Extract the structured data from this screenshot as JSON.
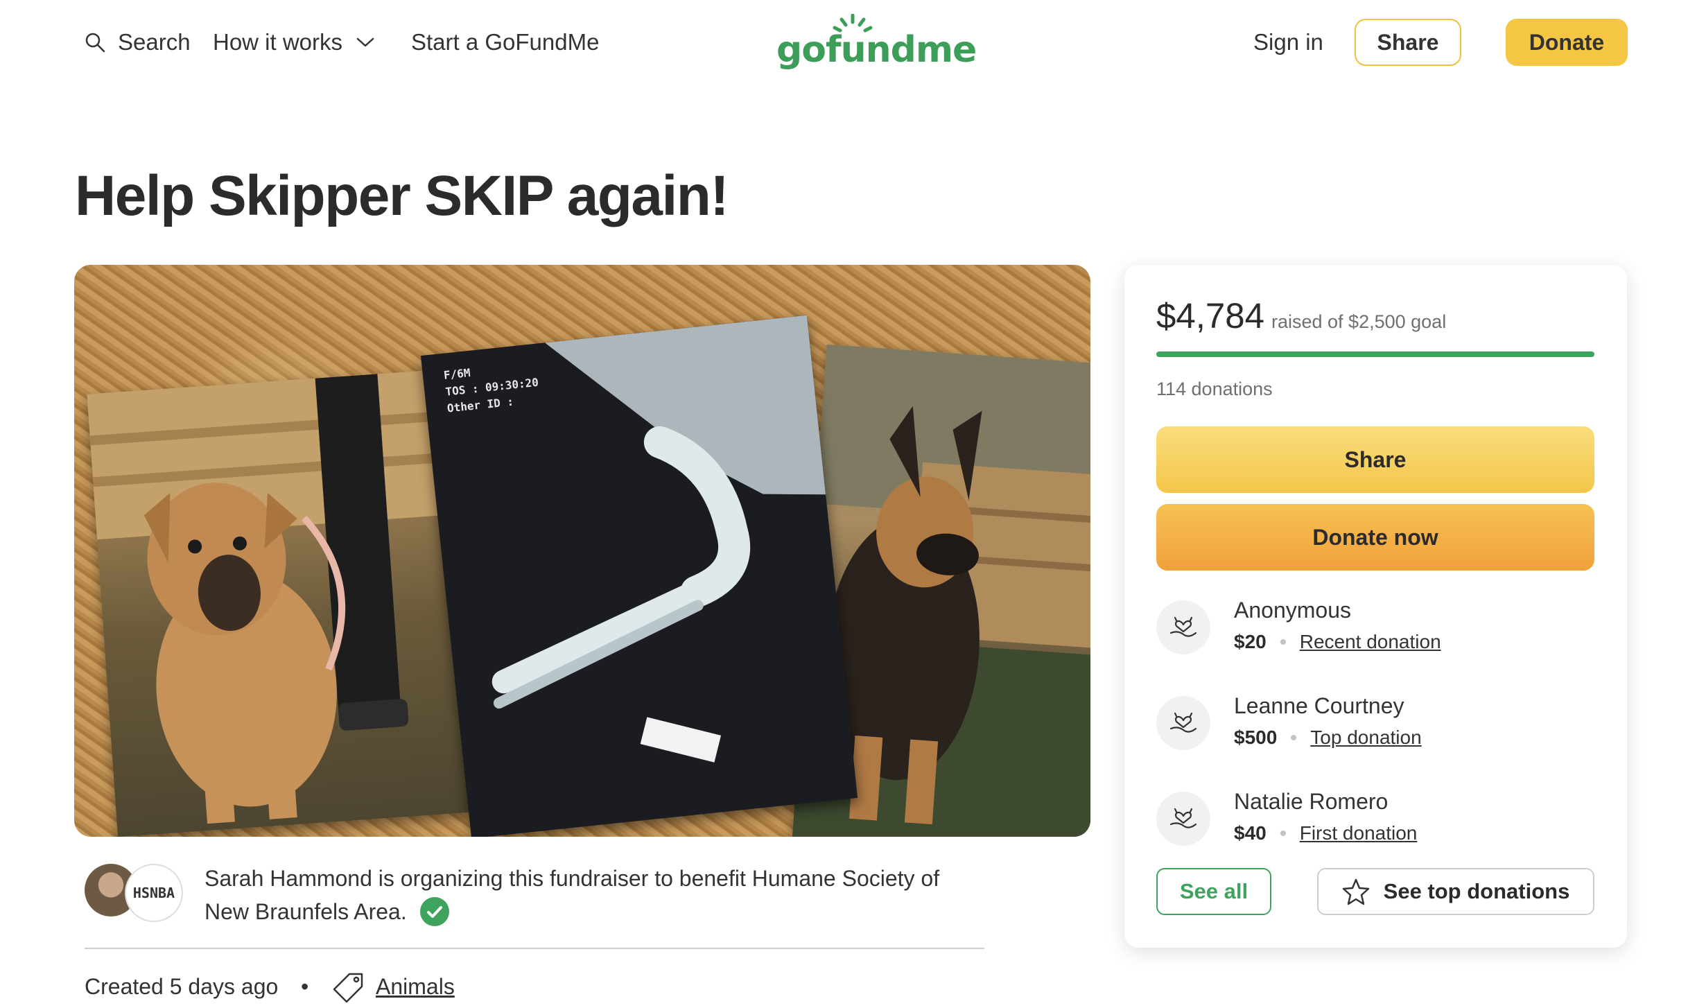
{
  "nav": {
    "search_label": "Search",
    "how_it_works_label": "How it works",
    "start_label": "Start a GoFundMe",
    "logo_text": "gofundme",
    "sign_in_label": "Sign in",
    "share_label": "Share",
    "donate_label": "Donate"
  },
  "campaign": {
    "title": "Help Skipper SKIP again!",
    "image": {
      "xray_caption_lines": [
        "F/6M",
        "TOS : 09:30:20",
        "Other ID :"
      ]
    },
    "organizer_logo_text": "HSNBA",
    "organizer_text": "Sarah Hammond is organizing this fundraiser to benefit Humane Society of New Braunfels Area.",
    "created_text": "Created 5 days ago",
    "separator": "•",
    "category": "Animals"
  },
  "sidebar": {
    "raised_amount": "$4,784",
    "raised_text": "raised of $2,500 goal",
    "progress_fraction": 1.0,
    "donations_count": "114 donations",
    "share_button": "Share",
    "donate_now_button": "Donate now",
    "donors": [
      {
        "name": "Anonymous",
        "amount": "$20",
        "label": "Recent donation"
      },
      {
        "name": "Leanne Courtney",
        "amount": "$500",
        "label": "Top donation"
      },
      {
        "name": "Natalie Romero",
        "amount": "$40",
        "label": "First donation"
      }
    ],
    "see_all_button": "See all",
    "see_top_button": "See top donations"
  },
  "colors": {
    "brand_green": "#3da35d",
    "accent_yellow": "#f5c544",
    "donate_orange": "#f0a13a"
  }
}
